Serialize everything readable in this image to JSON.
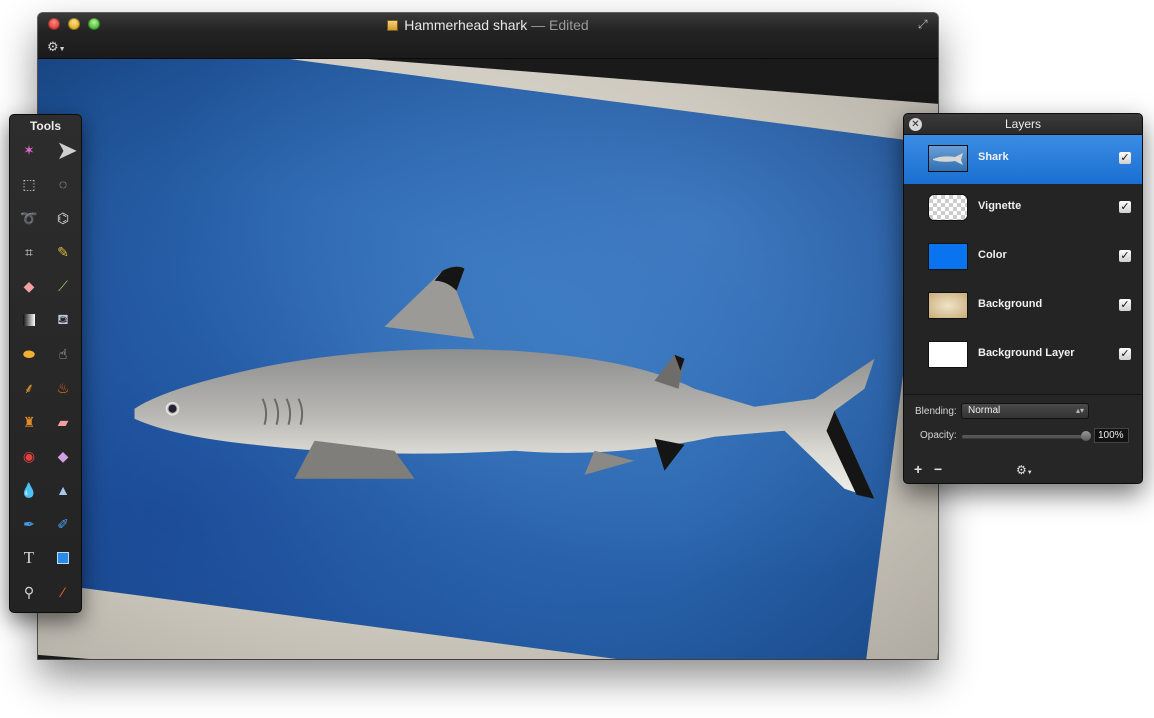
{
  "window": {
    "title": "Hammerhead shark",
    "edited_suffix": "— Edited"
  },
  "toolbar": {
    "gear_icon": "gear-icon",
    "fullscreen_icon": "fullscreen-icon"
  },
  "tools_panel": {
    "title": "Tools",
    "tools": [
      "magic-wand-icon",
      "arrow-move-icon",
      "rect-select-icon",
      "ellipse-select-icon",
      "lasso-icon",
      "polygon-lasso-icon",
      "crop-icon",
      "pencil-icon",
      "eraser-icon",
      "brush-icon",
      "gradient-icon",
      "paint-bucket-icon",
      "sponge-icon",
      "smudge-icon",
      "broom-icon",
      "burn-icon",
      "clone-stamp-icon",
      "bandage-icon",
      "red-eye-icon",
      "blur-eraser-icon",
      "drop-icon",
      "sharpen-icon",
      "pen-icon",
      "freeform-pen-icon",
      "type-icon",
      "shape-icon",
      "zoom-icon",
      "eyedropper-icon"
    ]
  },
  "layers_panel": {
    "title": "Layers",
    "layers": [
      {
        "name": "Shark",
        "visible": true,
        "selected": true,
        "thumb": "shark"
      },
      {
        "name": "Vignette",
        "visible": true,
        "selected": false,
        "thumb": "checker"
      },
      {
        "name": "Color",
        "visible": true,
        "selected": false,
        "thumb": "blue"
      },
      {
        "name": "Background",
        "visible": true,
        "selected": false,
        "thumb": "paper"
      },
      {
        "name": "Background Layer",
        "visible": true,
        "selected": false,
        "thumb": "white"
      }
    ],
    "blending_label": "Blending:",
    "blending_value": "Normal",
    "opacity_label": "Opacity:",
    "opacity_value": "100%",
    "opacity_fraction": 1.0,
    "add_label": "+",
    "remove_label": "−"
  },
  "colors": {
    "selection": "#1a6fd1",
    "swatch_blue": "#0a73f0"
  }
}
